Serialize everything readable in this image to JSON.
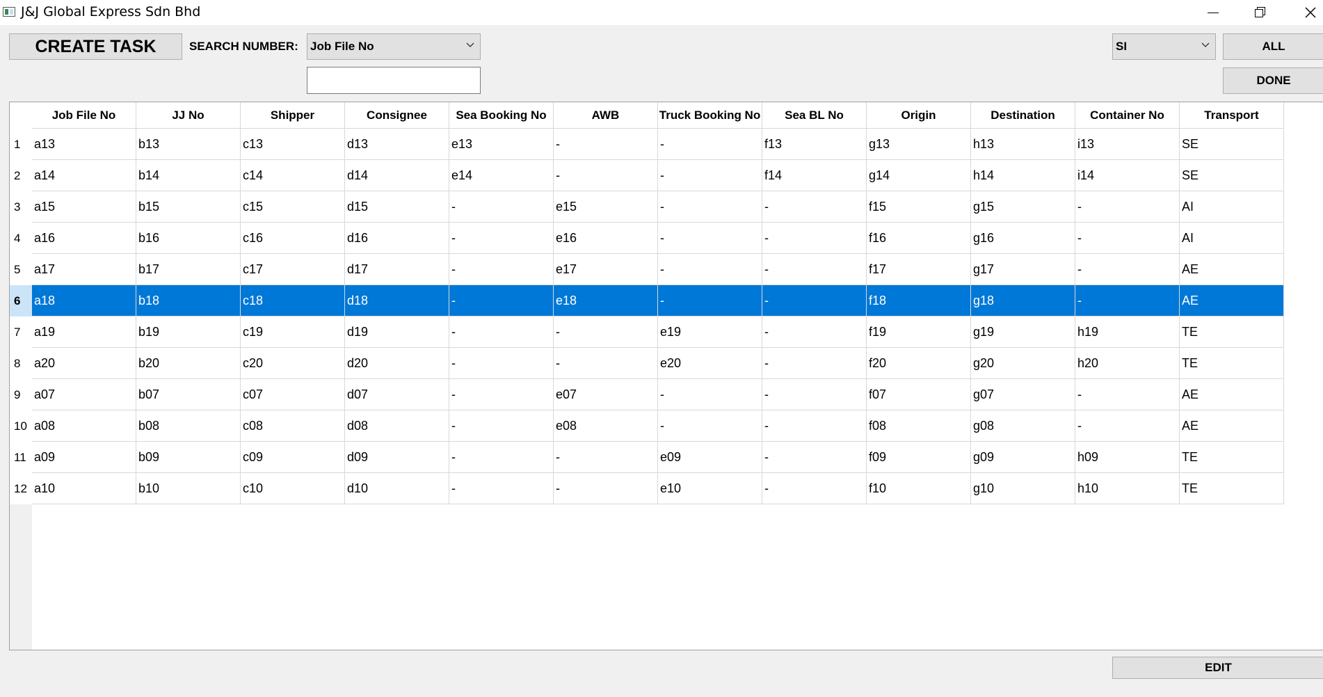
{
  "window": {
    "title": "J&J Global Express Sdn Bhd"
  },
  "toolbar": {
    "create_task_label": "CREATE TASK",
    "search_number_label": "SEARCH NUMBER:",
    "search_type_selected": "Job File No",
    "search_value": "",
    "filter_selected": "SI",
    "all_label": "ALL",
    "done_label": "DONE",
    "edit_label": "EDIT"
  },
  "table": {
    "columns": [
      "Job File No",
      "JJ No",
      "Shipper",
      "Consignee",
      "Sea Booking No",
      "AWB",
      "Truck Booking No",
      "Sea BL No",
      "Origin",
      "Destination",
      "Container No",
      "Transport"
    ],
    "selected_row": 6,
    "rows": [
      {
        "num": "1",
        "cells": [
          "a13",
          "b13",
          "c13",
          "d13",
          "e13",
          "-",
          "-",
          "f13",
          "g13",
          "h13",
          "i13",
          "SE"
        ]
      },
      {
        "num": "2",
        "cells": [
          "a14",
          "b14",
          "c14",
          "d14",
          "e14",
          "-",
          "-",
          "f14",
          "g14",
          "h14",
          "i14",
          "SE"
        ]
      },
      {
        "num": "3",
        "cells": [
          "a15",
          "b15",
          "c15",
          "d15",
          "-",
          "e15",
          "-",
          "-",
          "f15",
          "g15",
          "-",
          "AI"
        ]
      },
      {
        "num": "4",
        "cells": [
          "a16",
          "b16",
          "c16",
          "d16",
          "-",
          "e16",
          "-",
          "-",
          "f16",
          "g16",
          "-",
          "AI"
        ]
      },
      {
        "num": "5",
        "cells": [
          "a17",
          "b17",
          "c17",
          "d17",
          "-",
          "e17",
          "-",
          "-",
          "f17",
          "g17",
          "-",
          "AE"
        ]
      },
      {
        "num": "6",
        "cells": [
          "a18",
          "b18",
          "c18",
          "d18",
          "-",
          "e18",
          "-",
          "-",
          "f18",
          "g18",
          "-",
          "AE"
        ]
      },
      {
        "num": "7",
        "cells": [
          "a19",
          "b19",
          "c19",
          "d19",
          "-",
          "-",
          "e19",
          "-",
          "f19",
          "g19",
          "h19",
          "TE"
        ]
      },
      {
        "num": "8",
        "cells": [
          "a20",
          "b20",
          "c20",
          "d20",
          "-",
          "-",
          "e20",
          "-",
          "f20",
          "g20",
          "h20",
          "TE"
        ]
      },
      {
        "num": "9",
        "cells": [
          "a07",
          "b07",
          "c07",
          "d07",
          "-",
          "e07",
          "-",
          "-",
          "f07",
          "g07",
          "-",
          "AE"
        ]
      },
      {
        "num": "10",
        "cells": [
          "a08",
          "b08",
          "c08",
          "d08",
          "-",
          "e08",
          "-",
          "-",
          "f08",
          "g08",
          "-",
          "AE"
        ]
      },
      {
        "num": "11",
        "cells": [
          "a09",
          "b09",
          "c09",
          "d09",
          "-",
          "-",
          "e09",
          "-",
          "f09",
          "g09",
          "h09",
          "TE"
        ]
      },
      {
        "num": "12",
        "cells": [
          "a10",
          "b10",
          "c10",
          "d10",
          "-",
          "-",
          "e10",
          "-",
          "f10",
          "g10",
          "h10",
          "TE"
        ]
      }
    ]
  },
  "colors": {
    "selection": "#0078d7",
    "selection_header": "#cce4f7",
    "button_face": "#e1e1e1"
  }
}
